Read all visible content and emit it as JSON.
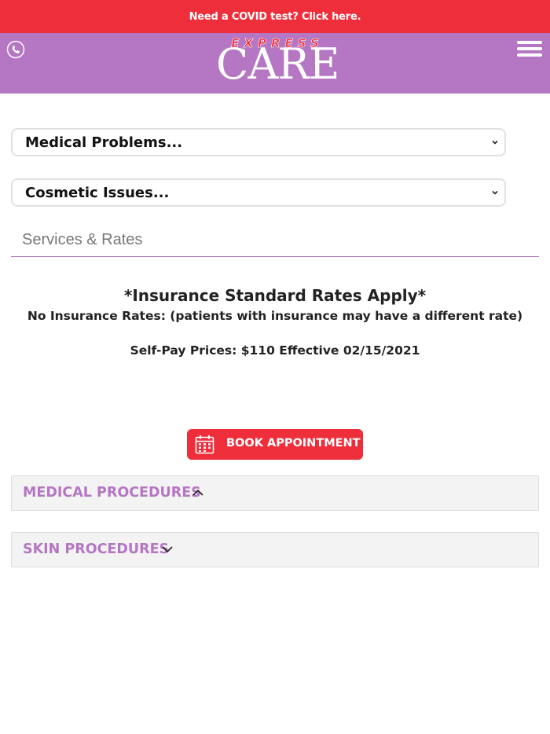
{
  "top_banner": {
    "link_text": "Need a COVID test? Click here."
  },
  "header": {
    "logo_top": "EXPRESS",
    "logo_main": "CARE",
    "phone_icon": "phone-icon",
    "menu_icon": "hamburger-menu-icon",
    "background_color": "#b576c4",
    "banner_color": "#ee2e3b"
  },
  "filters": {
    "medical_select": "Medical Problems...",
    "cosmetic_select": "Cosmetic Issues..."
  },
  "tabs": {
    "services": "Services & Rates"
  },
  "rates": {
    "title": "*Insurance Standard Rates Apply*",
    "subtitle": "No Insurance Rates: (patients with insurance may have a different rate)",
    "self_pay": "Self-Pay Prices: $110 Effective 02/15/2021"
  },
  "booking": {
    "button_label": "BOOK APPOINTMENT",
    "icon": "calendar-icon"
  },
  "accordions": [
    {
      "title": "MEDICAL PROCEDURES",
      "state": "expanded"
    },
    {
      "title": "SKIN PROCEDURES",
      "state": "collapsed"
    }
  ]
}
